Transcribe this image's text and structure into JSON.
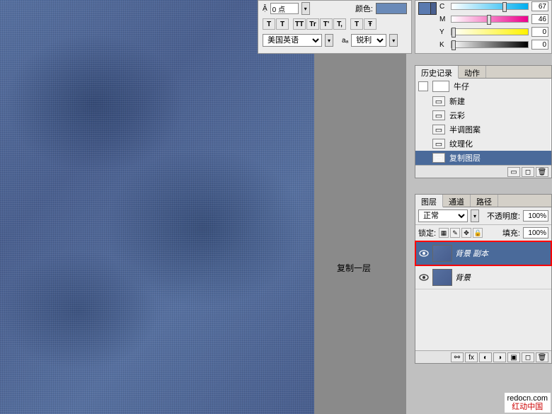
{
  "canvas": {
    "description": "蓝色牛仔布纹理"
  },
  "work_label": "复制一层",
  "char_panel": {
    "leading_label": "0 点",
    "color_label": "颜色:",
    "type_buttons": [
      "T",
      "T",
      "TT",
      "Tr",
      "T'",
      "T,",
      "T",
      "Ŧ"
    ],
    "lang_select": "美国英语",
    "aa_prefix": "aₐ",
    "aa_select": "锐利"
  },
  "color": {
    "channels": [
      {
        "label": "C",
        "value": "67",
        "cls": "cmyk-c",
        "pos": 67
      },
      {
        "label": "M",
        "value": "46",
        "cls": "cmyk-m",
        "pos": 46
      },
      {
        "label": "Y",
        "value": "0",
        "cls": "cmyk-y",
        "pos": 0
      },
      {
        "label": "K",
        "value": "0",
        "cls": "cmyk-k",
        "pos": 0
      }
    ]
  },
  "history": {
    "tab_history": "历史记录",
    "tab_actions": "动作",
    "snapshot": "牛仔",
    "items": [
      {
        "label": "新建",
        "icon": "new"
      },
      {
        "label": "云彩",
        "icon": "filter"
      },
      {
        "label": "半调图案",
        "icon": "filter"
      },
      {
        "label": "纹理化",
        "icon": "filter"
      },
      {
        "label": "复制图层",
        "icon": "dup",
        "active": true
      }
    ]
  },
  "layers": {
    "tab_layers": "图层",
    "tab_channels": "通道",
    "tab_paths": "路径",
    "blend_mode": "正常",
    "opacity_label": "不透明度:",
    "opacity_value": "100%",
    "lock_label": "锁定:",
    "fill_label": "填充:",
    "fill_value": "100%",
    "items": [
      {
        "name": "背景 副本",
        "selected": true,
        "highlighted": true
      },
      {
        "name": "背景",
        "selected": false,
        "highlighted": false
      }
    ]
  },
  "watermark": {
    "url": "redocn.com",
    "cn": "红动中国"
  }
}
